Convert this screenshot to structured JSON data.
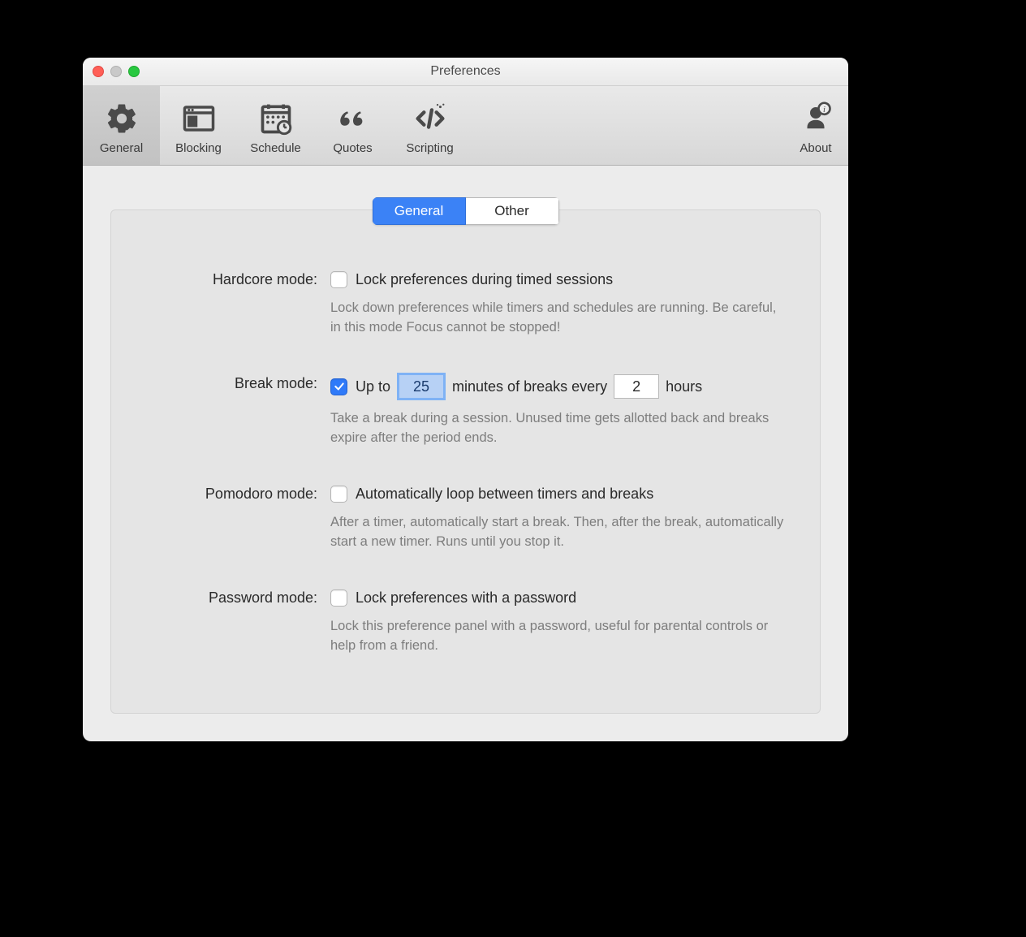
{
  "window": {
    "title": "Preferences"
  },
  "toolbar": {
    "items": [
      {
        "id": "general",
        "label": "General"
      },
      {
        "id": "blocking",
        "label": "Blocking"
      },
      {
        "id": "schedule",
        "label": "Schedule"
      },
      {
        "id": "quotes",
        "label": "Quotes"
      },
      {
        "id": "scripting",
        "label": "Scripting"
      }
    ],
    "about": {
      "label": "About"
    },
    "selected": "general"
  },
  "segmented": {
    "active": "General",
    "inactive": "Other"
  },
  "rows": {
    "hardcore": {
      "label": "Hardcore mode:",
      "checkbox_label": "Lock preferences during timed sessions",
      "checked": false,
      "desc": "Lock down preferences while timers and schedules are running. Be careful, in this mode Focus cannot be stopped!"
    },
    "break": {
      "label": "Break mode:",
      "checked": true,
      "prefix": "Up to",
      "minutes": "25",
      "mid": "minutes of breaks every",
      "hours": "2",
      "suffix": "hours",
      "desc": "Take a break during a session. Unused time gets allotted back and breaks expire after the period ends."
    },
    "pomodoro": {
      "label": "Pomodoro mode:",
      "checkbox_label": "Automatically loop between timers and breaks",
      "checked": false,
      "desc": "After a timer, automatically start a break. Then, after the break, automatically start a new timer. Runs until you stop it."
    },
    "password": {
      "label": "Password mode:",
      "checkbox_label": "Lock preferences with a password",
      "checked": false,
      "desc": "Lock this preference panel with a password, useful for parental controls or help from a friend."
    }
  }
}
